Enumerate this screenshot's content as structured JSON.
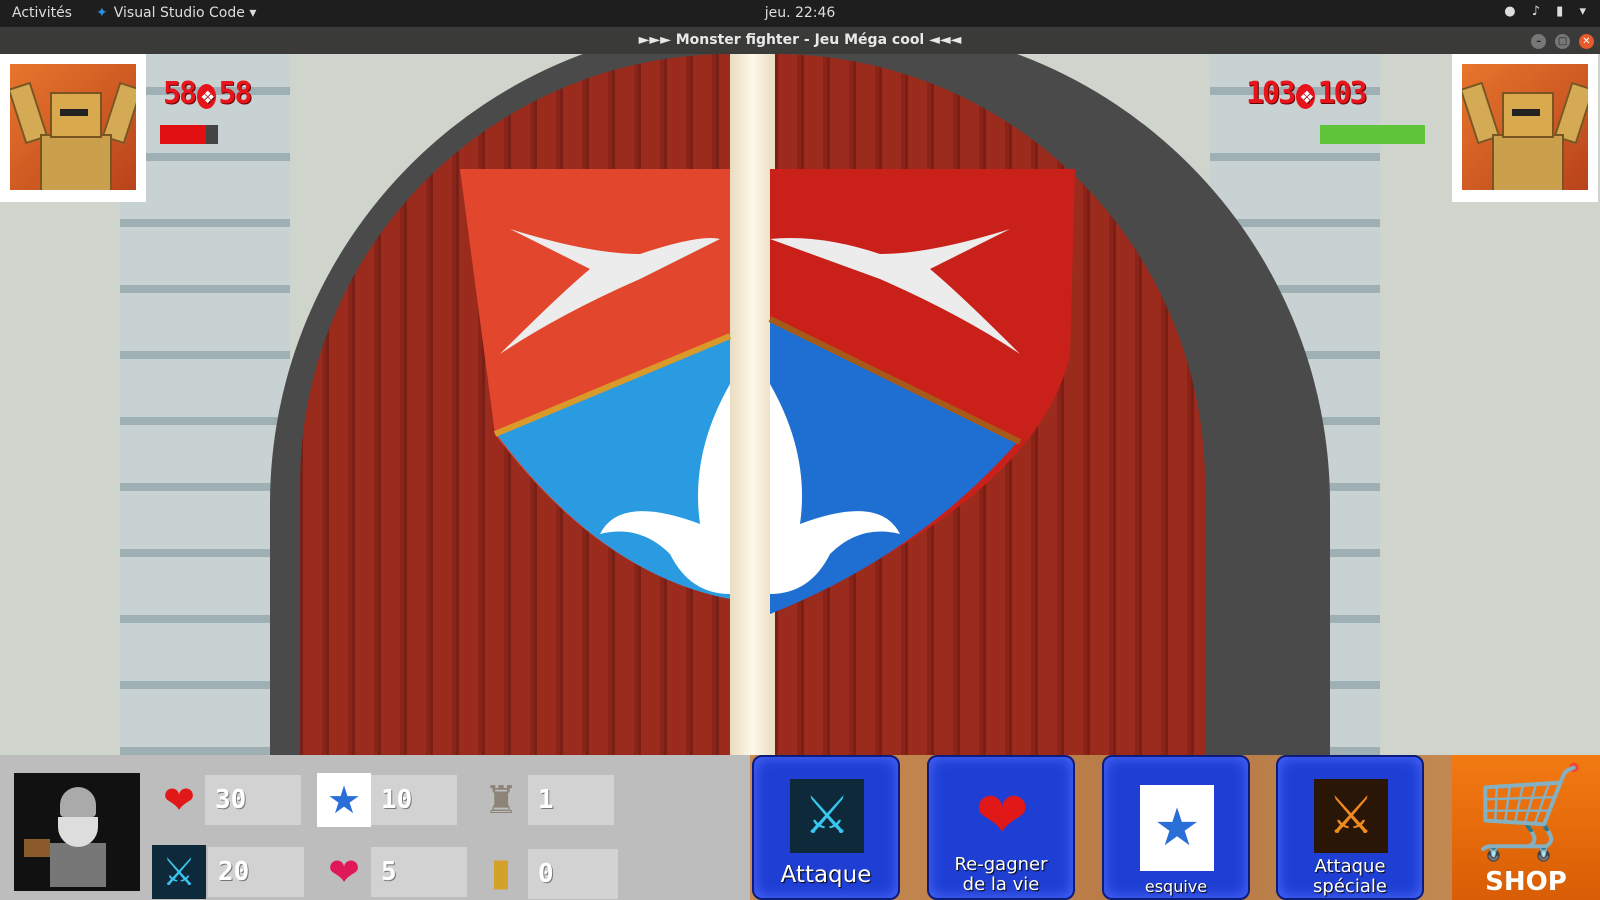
{
  "system_bar": {
    "activities": "Activités",
    "app_name": "Visual Studio Code",
    "clock": "jeu. 22:46"
  },
  "window": {
    "title": "►►► Monster fighter - Jeu Méga cool ◄◄◄"
  },
  "player": {
    "hp_current": "58",
    "hp_max": "58",
    "hp_fraction": 0.8,
    "hp_bar_color": "#e01010"
  },
  "enemy": {
    "hp_current": "103",
    "hp_max": "103",
    "hp_fraction": 1.0,
    "hp_bar_color": "#5fc43a"
  },
  "stats": {
    "life": "30",
    "dodge": "10",
    "tower": "1",
    "attack": "20",
    "potions": "5",
    "gold": "0"
  },
  "actions": {
    "attack": "Attaque",
    "regain_line1": "Re-gagner",
    "regain_line2": "de la vie",
    "dodge": "esquive",
    "special_line1": "Attaque",
    "special_line2": "spéciale",
    "shop": "SHOP"
  },
  "icons": {
    "attack": "crossed-swords-icon",
    "heal": "heart-icon",
    "dodge": "dodge-figure-icon",
    "special": "flaming-swords-icon",
    "shop": "cart-icon"
  }
}
